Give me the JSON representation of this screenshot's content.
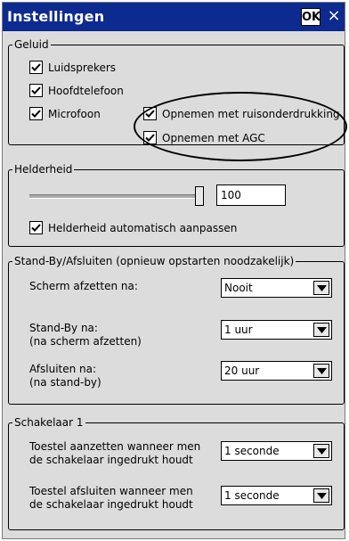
{
  "window": {
    "title": "Instellingen",
    "ok_label": "OK",
    "close_symbol": "×"
  },
  "sound": {
    "legend": "Geluid",
    "speakers": "Luidsprekers",
    "headphones": "Hoofdtelefoon",
    "microphone": "Microfoon",
    "record_noise": "Opnemen met ruisonderdrukking",
    "record_agc": "Opnemen met AGC"
  },
  "brightness": {
    "legend": "Helderheid",
    "value": "100",
    "level_percent": 100,
    "auto_label": "Helderheid automatisch aanpassen"
  },
  "standby": {
    "legend": "Stand-By/Afsluiten (opnieuw opstarten noodzakelijk)",
    "screen_off_label": "Scherm afzetten na:",
    "screen_off_value": "Nooit",
    "standby_label": "Stand-By na:",
    "standby_sub": "(na scherm afzetten)",
    "standby_value": "1 uur",
    "shutdown_label": "Afsluiten na:",
    "shutdown_sub": "(na stand-by)",
    "shutdown_value": "20 uur"
  },
  "switch": {
    "legend": "Schakelaar 1",
    "on_line1": "Toestel aanzetten wanneer men",
    "on_line2": "de schakelaar ingedrukt houdt",
    "on_value": "1 seconde",
    "off_line1": "Toestel afsluiten wanneer men",
    "off_line2": "de schakelaar ingedrukt houdt",
    "off_value": "1 seconde"
  }
}
